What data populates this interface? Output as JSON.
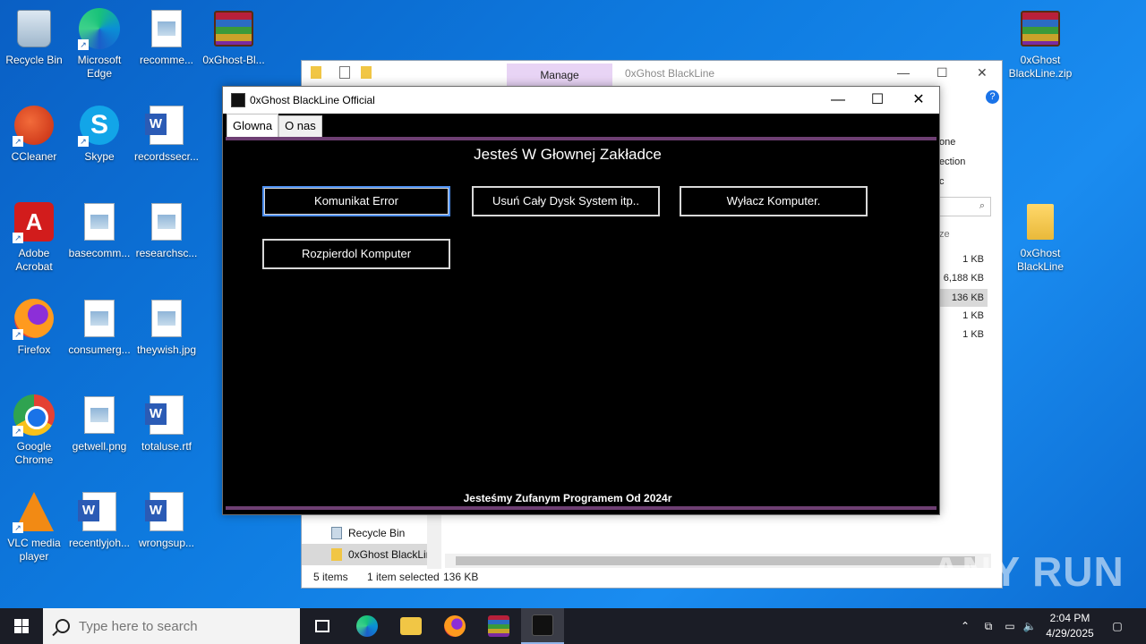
{
  "desktop": {
    "icons": [
      {
        "label": "Recycle Bin"
      },
      {
        "label": "Microsoft Edge"
      },
      {
        "label": "recomme..."
      },
      {
        "label": "0xGhost-Bl..."
      },
      {
        "label": "CCleaner"
      },
      {
        "label": "Skype"
      },
      {
        "label": "recordssecr..."
      },
      {
        "label": "Adobe Acrobat"
      },
      {
        "label": "basecomm..."
      },
      {
        "label": "researchsc..."
      },
      {
        "label": "Firefox"
      },
      {
        "label": "consumerg..."
      },
      {
        "label": "theywish.jpg"
      },
      {
        "label": "Google Chrome"
      },
      {
        "label": "getwell.png"
      },
      {
        "label": "totaluse.rtf"
      },
      {
        "label": "VLC media player"
      },
      {
        "label": "recentlyjoh..."
      },
      {
        "label": "wrongsup..."
      },
      {
        "label": "0xGhost BlackLine.zip"
      },
      {
        "label": "0xGhost BlackLine"
      }
    ]
  },
  "explorer": {
    "tab_manage": "Manage",
    "title": "0xGhost BlackLine",
    "ribbon_fragments": [
      "one",
      "ection",
      "c"
    ],
    "column_fragment": "ze",
    "sizes": [
      "1 KB",
      "6,188 KB",
      "136 KB",
      "1 KB",
      "1 KB"
    ],
    "nav_items": [
      "Recycle Bin",
      "0xGhost BlackLin"
    ],
    "status": {
      "items": "5 items",
      "selected": "1 item selected",
      "size": "136 KB"
    }
  },
  "app": {
    "title": "0xGhost BlackLine Official",
    "tabs": [
      "Glowna",
      "O nas"
    ],
    "heading": "Jesteś W Głownej Zakładce",
    "buttons": [
      "Komunikat Error",
      "Usuń Cały Dysk System itp..",
      "Wyłacz Komputer.",
      "Rozpierdol Komputer"
    ],
    "footer": "Jesteśmy Zufanym Programem Od 2024r"
  },
  "watermark": "ANY RUN",
  "taskbar": {
    "search_placeholder": "Type here to search",
    "time": "2:04 PM",
    "date": "4/29/2025"
  }
}
